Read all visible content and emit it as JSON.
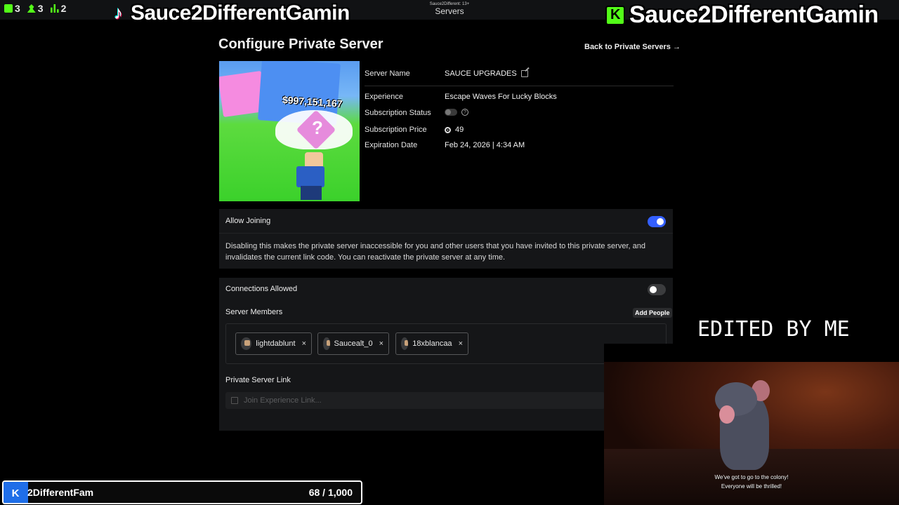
{
  "overlay": {
    "stats": [
      {
        "icon": "kick-icon",
        "value": "3"
      },
      {
        "icon": "person-icon",
        "value": "3"
      },
      {
        "icon": "bar-chart-icon",
        "value": "2"
      }
    ],
    "streamer_name_left": "Sauce2DifferentGamin",
    "streamer_name_right": "Sauce2DifferentGamin",
    "top_center_tiny": "Sauce2Different: 13+",
    "top_center_title": "Servers",
    "edited_text": "EDITED BY ME",
    "video_subtitle_line1": "We've got to go to the colony!",
    "video_subtitle_line2": "Everyone will be thrilled!",
    "follower_goal": {
      "name": "2DifferentFam",
      "count": "68 / 1,000",
      "progress": 0.068
    }
  },
  "page": {
    "title": "Configure Private Server",
    "back_link": "Back to Private Servers →",
    "thumbnail_money_text": "$997,151,167",
    "details": {
      "server_name_label": "Server Name",
      "server_name_value": "SAUCE UPGRADES",
      "experience_label": "Experience",
      "experience_value": "Escape Waves For Lucky Blocks",
      "subscription_status_label": "Subscription Status",
      "subscription_status_on": false,
      "subscription_price_label": "Subscription Price",
      "subscription_price_value": "49",
      "expiration_label": "Expiration Date",
      "expiration_value": "Feb 24, 2026 | 4:34 AM"
    },
    "allow_joining": {
      "label": "Allow Joining",
      "enabled": true,
      "description": "Disabling this makes the private server inaccessible for you and other users that you have invited to this private server, and invalidates the current link code. You can reactivate the private server at any time."
    },
    "connections": {
      "label": "Connections Allowed",
      "enabled": false
    },
    "members": {
      "label": "Server Members",
      "add_button": "Add People",
      "list": [
        {
          "name": "lightdablunt"
        },
        {
          "name": "Saucealt_0"
        },
        {
          "name": "18xblancaa"
        }
      ],
      "remove_glyph": "×"
    },
    "private_link": {
      "label": "Private Server Link",
      "placeholder": "Join Experience Link..."
    }
  },
  "colors": {
    "accent_blue": "#335fff",
    "kick_green": "#53fc18",
    "panel_bg": "#151618"
  }
}
